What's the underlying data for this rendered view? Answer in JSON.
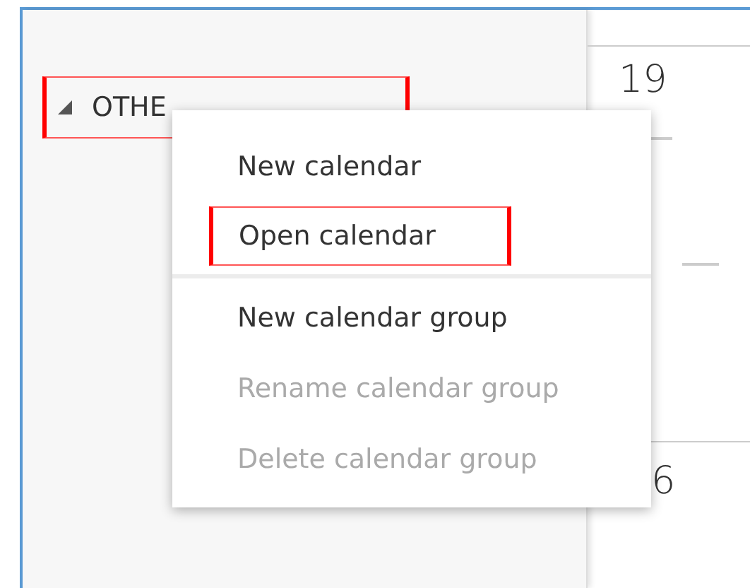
{
  "sidebar": {
    "group": {
      "label": "OTHE",
      "expanded": true,
      "highlighted": true
    }
  },
  "calendar": {
    "days": [
      "19",
      "6"
    ]
  },
  "context_menu": {
    "sections": [
      [
        {
          "label": "New calendar",
          "disabled": false,
          "highlighted": false
        },
        {
          "label": "Open calendar",
          "disabled": false,
          "highlighted": true
        }
      ],
      [
        {
          "label": "New calendar group",
          "disabled": false,
          "highlighted": false
        },
        {
          "label": "Rename calendar group",
          "disabled": true,
          "highlighted": false
        },
        {
          "label": "Delete calendar group",
          "disabled": true,
          "highlighted": false
        }
      ]
    ]
  }
}
